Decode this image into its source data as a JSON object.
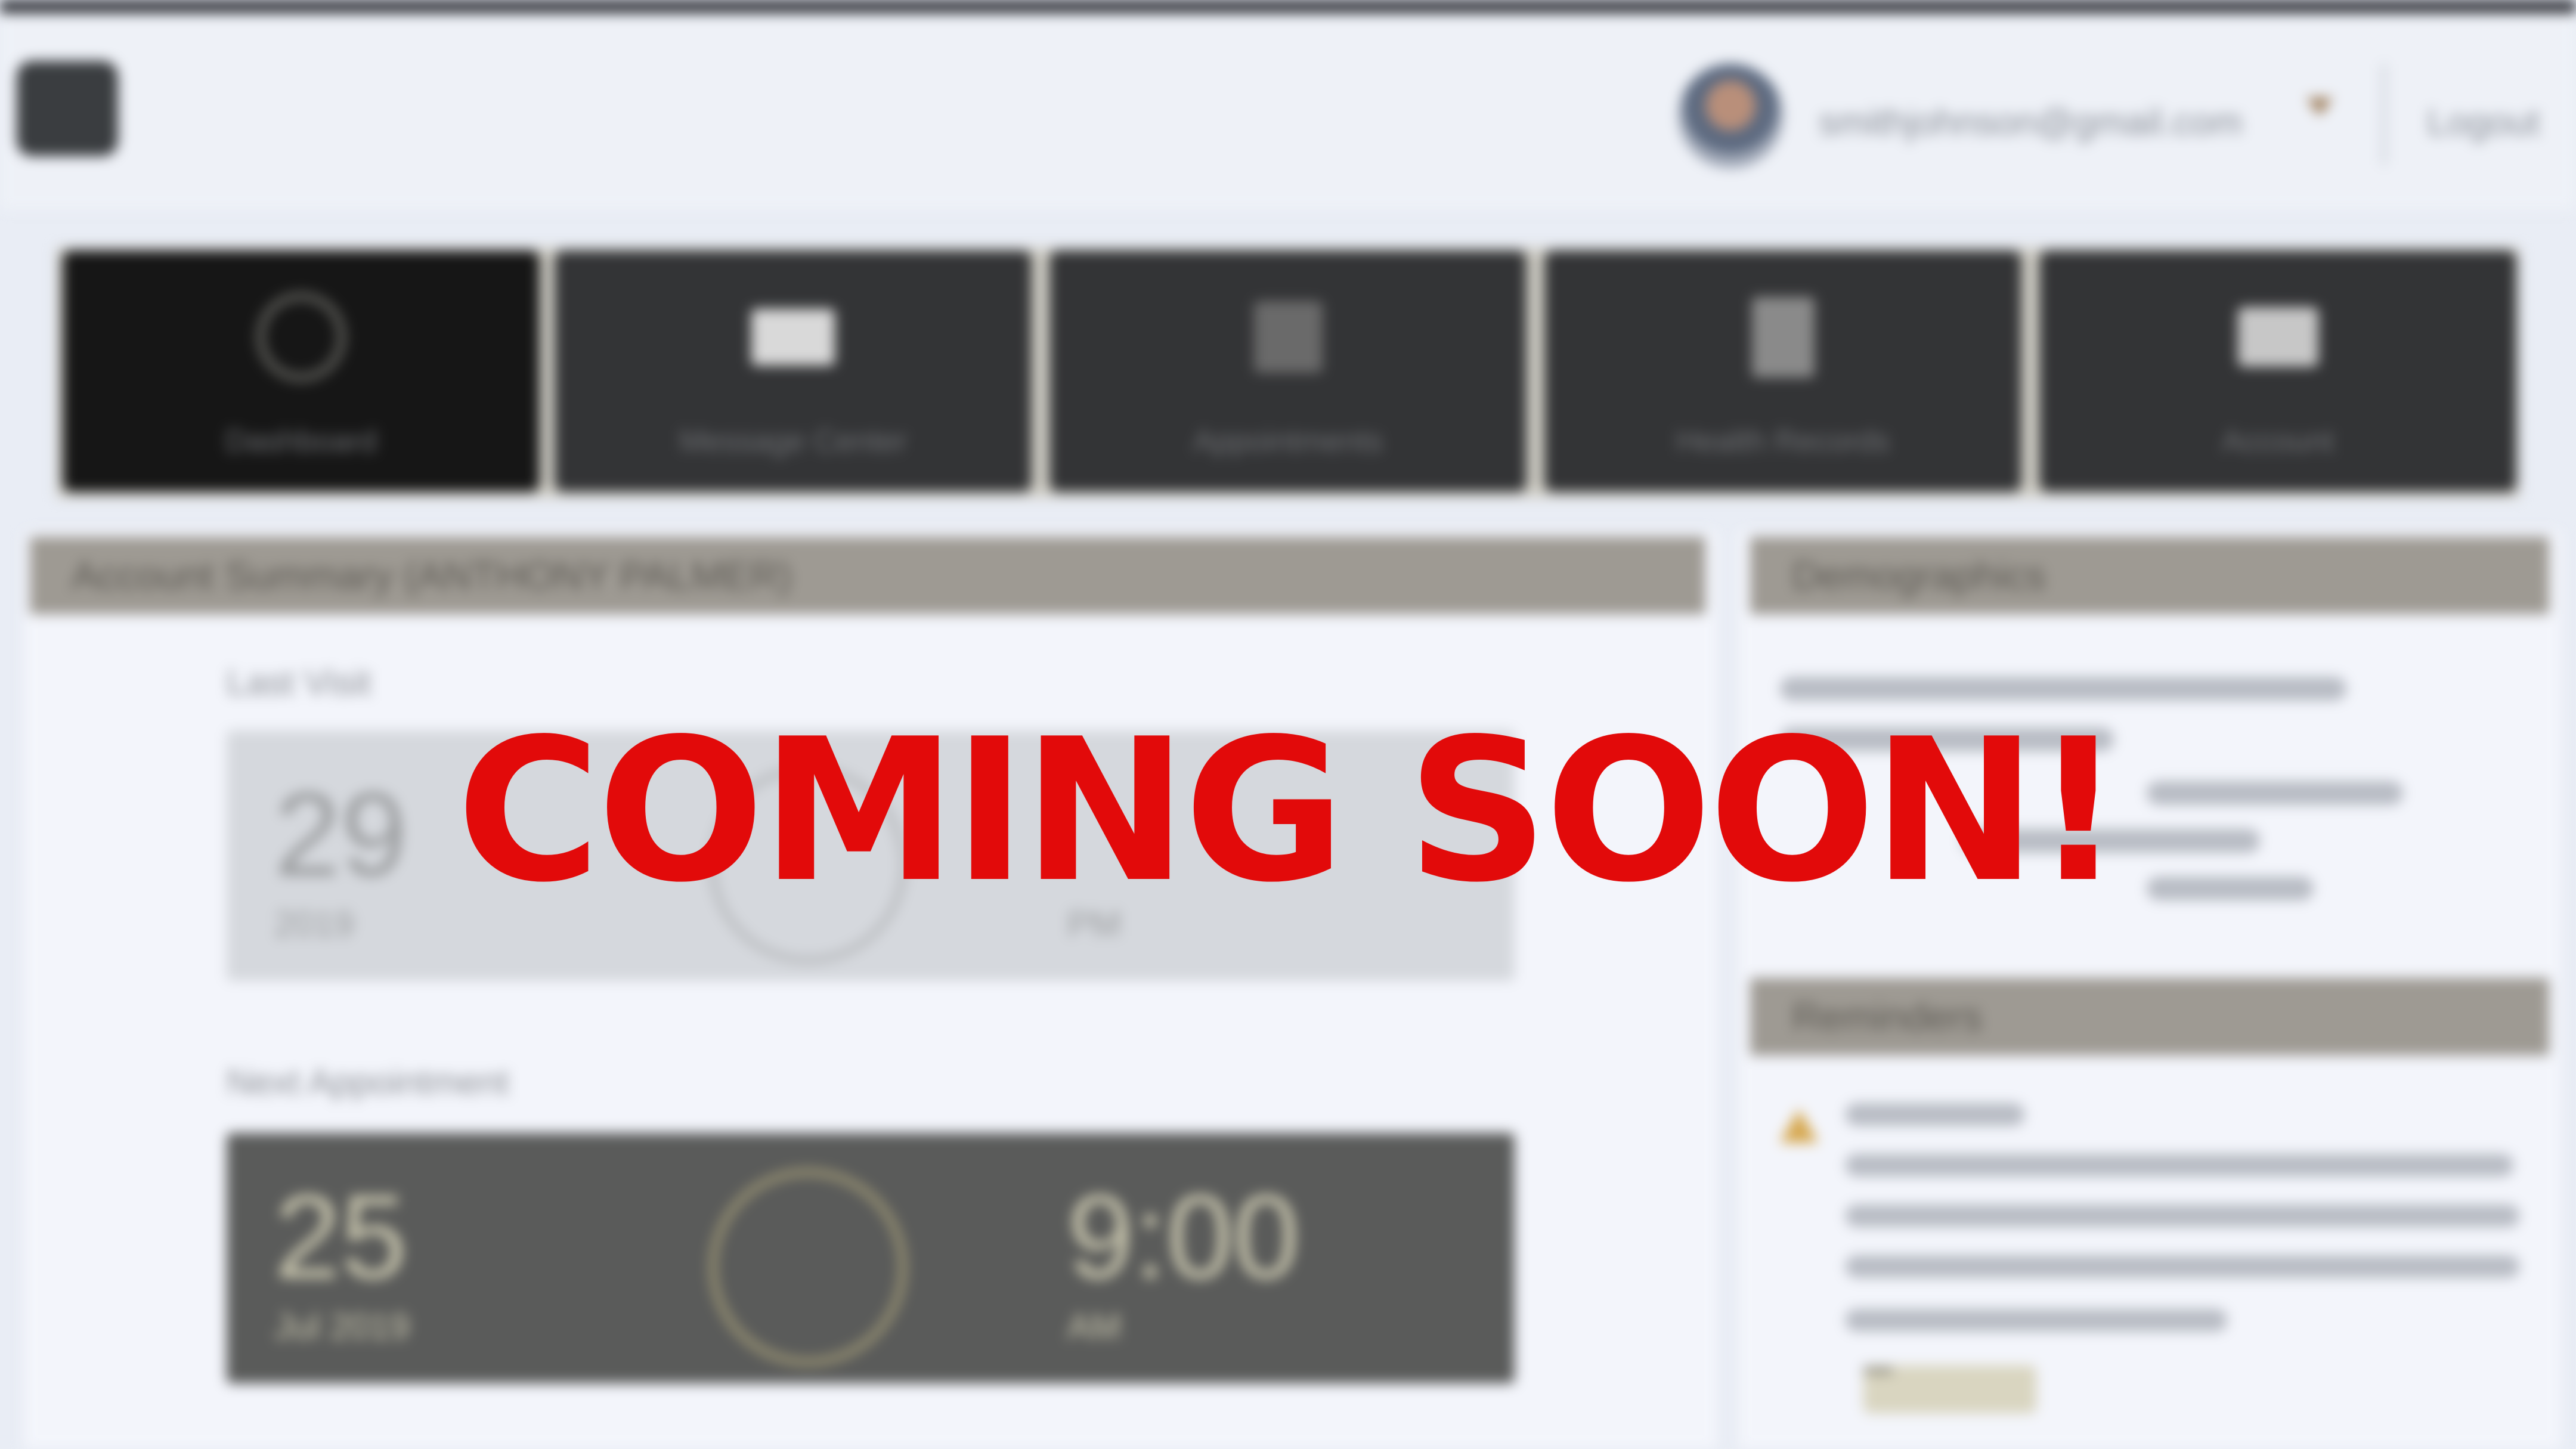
{
  "overlay": {
    "text": "COMING SOON!",
    "color": "#e20a0a"
  },
  "header": {
    "menu_icon": "app-menu-icon",
    "user_email": "smithjohnson@gmail.com",
    "dropdown_icon": "caret-down-icon",
    "logout_label": "Logout"
  },
  "nav": {
    "tabs": [
      {
        "label": "Dashboard",
        "icon": "dashboard-icon",
        "active": true
      },
      {
        "label": "Message Center",
        "icon": "envelope-icon",
        "active": false
      },
      {
        "label": "Appointments",
        "icon": "calendar-icon",
        "active": false
      },
      {
        "label": "Health Records",
        "icon": "document-icon",
        "active": false
      },
      {
        "label": "Account",
        "icon": "briefcase-icon",
        "active": false
      }
    ]
  },
  "summary": {
    "header": "Account Summary (ANTHONY PALMER)",
    "last_visit": {
      "label": "Last Visit",
      "day": "29",
      "month_year": "2019",
      "time": "",
      "ampm": "PM"
    },
    "next_appointment": {
      "label": "Next Appointment",
      "day": "25",
      "month_year": "Jul 2019",
      "time": "9:00",
      "ampm": "AM"
    }
  },
  "demographics": {
    "header": "Demographics"
  },
  "reminders": {
    "header": "Reminders",
    "alert_icon": "warning-icon",
    "button_label": "Details"
  }
}
